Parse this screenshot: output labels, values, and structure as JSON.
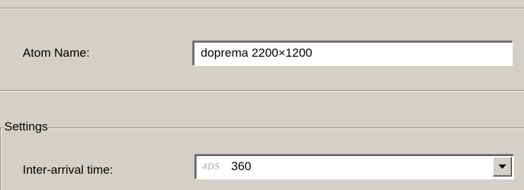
{
  "atom_name": {
    "label": "Atom Name:",
    "value": "doprema 2200×1200"
  },
  "settings": {
    "group_label": "Settings",
    "inter_arrival": {
      "label": "Inter-arrival time:",
      "prefix": "4DS",
      "value": "360",
      "dropdown_icon": "chevron-down-icon"
    }
  }
}
